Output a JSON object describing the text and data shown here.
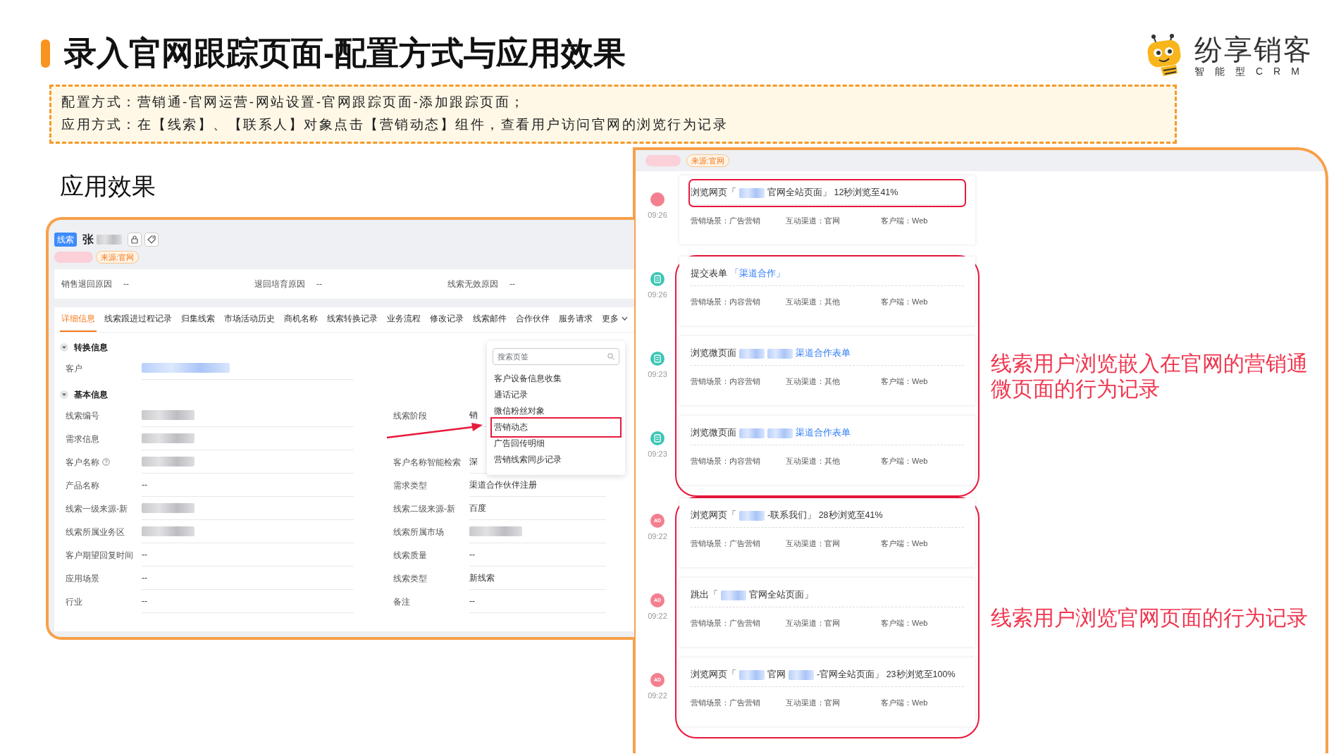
{
  "title": "录入官网跟踪页面-配置方式与应用效果",
  "logo": {
    "name": "纷享销客",
    "tagline": "智能型CRM"
  },
  "config_box": {
    "lines": [
      "配置方式：营销通-官网运营-网站设置-官网跟踪页面-添加跟踪页面；",
      "应用方式：在【线索】、【联系人】对象点击【营销动态】组件，查看用户访问官网的浏览行为记录"
    ]
  },
  "section_heading": "应用效果",
  "lead_detail": {
    "object_tag": "线索",
    "name": "张",
    "source_tag": "来源:官网",
    "summary": [
      {
        "label": "销售退回原因",
        "value": "--"
      },
      {
        "label": "退回培育原因",
        "value": "--"
      },
      {
        "label": "线索无效原因",
        "value": "--"
      }
    ],
    "tabs": [
      {
        "label": "详细信息",
        "selected": true
      },
      {
        "label": "线索跟进过程记录",
        "selected": false
      },
      {
        "label": "归集线索",
        "selected": false
      },
      {
        "label": "市场活动历史",
        "selected": false
      },
      {
        "label": "商机名称",
        "selected": false
      },
      {
        "label": "线索转换记录",
        "selected": false
      },
      {
        "label": "业务流程",
        "selected": false
      },
      {
        "label": "修改记录",
        "selected": false
      },
      {
        "label": "线索邮件",
        "selected": false
      },
      {
        "label": "合作伙伴",
        "selected": false
      },
      {
        "label": "服务请求",
        "selected": false
      },
      {
        "label": "更多",
        "selected": false,
        "kind": "more"
      }
    ],
    "sections": [
      {
        "title": "转换信息",
        "expanded": true,
        "rows": [
          [
            {
              "label": "客户",
              "kind": "redacted_link"
            }
          ]
        ]
      },
      {
        "title": "基本信息",
        "expanded": true,
        "rows": [
          [
            {
              "label": "线索编号",
              "kind": "redacted"
            },
            {
              "label": "线索阶段",
              "kind": "text",
              "value": "销"
            }
          ],
          [
            {
              "label": "需求信息",
              "kind": "redacted"
            }
          ],
          [
            {
              "label": "客户名称",
              "kind": "redacted",
              "help": true
            },
            {
              "label": "客户名称智能检索",
              "kind": "text",
              "value": "深"
            }
          ],
          [
            {
              "label": "产品名称",
              "kind": "text",
              "value": "--"
            },
            {
              "label": "需求类型",
              "kind": "text",
              "value": "渠道合作伙伴注册"
            }
          ],
          [
            {
              "label": "线索一级来源-新",
              "kind": "redacted"
            },
            {
              "label": "线索二级来源-新",
              "kind": "text",
              "value": "百度"
            }
          ],
          [
            {
              "label": "线索所属业务区",
              "kind": "redacted"
            },
            {
              "label": "线索所属市场",
              "kind": "redacted"
            }
          ],
          [
            {
              "label": "客户期望回复时间",
              "kind": "text",
              "value": "--"
            },
            {
              "label": "线索质量",
              "kind": "text",
              "value": "--"
            }
          ],
          [
            {
              "label": "应用场景",
              "kind": "text",
              "value": "--"
            },
            {
              "label": "线索类型",
              "kind": "text",
              "value": "新线索"
            }
          ],
          [
            {
              "label": "行业",
              "kind": "text",
              "value": "--"
            },
            {
              "label": "备注",
              "kind": "text",
              "value": "--"
            }
          ]
        ]
      }
    ],
    "tab_menu": {
      "placeholder": "搜索页签",
      "items": [
        {
          "label": "客户设备信息收集",
          "highlighted": false
        },
        {
          "label": "通话记录",
          "highlighted": false
        },
        {
          "label": "微信粉丝对象",
          "highlighted": false
        },
        {
          "label": "营销动态",
          "highlighted": true
        },
        {
          "label": "广告回传明细",
          "highlighted": false
        },
        {
          "label": "营销线索同步记录",
          "highlighted": false
        }
      ]
    }
  },
  "activity_panel": {
    "source_tag": "来源:官网",
    "groups": [
      {
        "kind": "single",
        "events": [
          {
            "kind": "ad",
            "time": "09:26",
            "title_highlighted": true,
            "title": [
              {
                "kind": "text",
                "text": "浏览网页「"
              },
              {
                "kind": "redacted"
              },
              {
                "kind": "text",
                "text": "官网全站页面」 12秒浏览至41%"
              }
            ],
            "meta": [
              {
                "label": "营销场景：",
                "value": "广告营销"
              },
              {
                "label": "互动渠道：",
                "value": "官网"
              },
              {
                "label": "客户端：",
                "value": "Web"
              }
            ]
          }
        ]
      },
      {
        "kind": "group",
        "annotation": "线索用户浏览嵌入在官网的营销通微页面的行为记录",
        "events": [
          {
            "kind": "form",
            "time": "09:26",
            "title_highlighted": false,
            "title": [
              {
                "kind": "text",
                "text": "提交表单"
              },
              {
                "kind": "link",
                "text": "「渠道合作」"
              }
            ],
            "meta": [
              {
                "label": "营销场景：",
                "value": "内容营销"
              },
              {
                "label": "互动渠道：",
                "value": "其他"
              },
              {
                "label": "客户端：",
                "value": "Web"
              }
            ]
          },
          {
            "kind": "form",
            "time": "09:23",
            "title_highlighted": false,
            "title": [
              {
                "kind": "text",
                "text": "浏览微页面"
              },
              {
                "kind": "redacted"
              },
              {
                "kind": "redacted"
              },
              {
                "kind": "link",
                "text": "渠道合作表单"
              }
            ],
            "meta": [
              {
                "label": "营销场景：",
                "value": "内容营销"
              },
              {
                "label": "互动渠道：",
                "value": "其他"
              },
              {
                "label": "客户端：",
                "value": "Web"
              }
            ]
          },
          {
            "kind": "form",
            "time": "09:23",
            "title_highlighted": false,
            "title": [
              {
                "kind": "text",
                "text": "浏览微页面"
              },
              {
                "kind": "redacted"
              },
              {
                "kind": "redacted"
              },
              {
                "kind": "link",
                "text": "渠道合作表单"
              }
            ],
            "meta": [
              {
                "label": "营销场景：",
                "value": "内容营销"
              },
              {
                "label": "互动渠道：",
                "value": "其他"
              },
              {
                "label": "客户端：",
                "value": "Web"
              }
            ]
          }
        ]
      },
      {
        "kind": "group",
        "annotation": "线索用户浏览官网页面的行为记录",
        "events": [
          {
            "kind": "ad",
            "badge": "AD",
            "time": "09:22",
            "title_highlighted": false,
            "title": [
              {
                "kind": "text",
                "text": "浏览网页「"
              },
              {
                "kind": "redacted"
              },
              {
                "kind": "text",
                "text": "-联系我们」 28秒浏览至41%"
              }
            ],
            "meta": [
              {
                "label": "营销场景：",
                "value": "广告营销"
              },
              {
                "label": "互动渠道：",
                "value": "官网"
              },
              {
                "label": "客户端：",
                "value": "Web"
              }
            ]
          },
          {
            "kind": "ad",
            "badge": "AD",
            "time": "09:22",
            "title_highlighted": false,
            "title": [
              {
                "kind": "text",
                "text": "跳出「"
              },
              {
                "kind": "redacted"
              },
              {
                "kind": "text",
                "text": "官网全站页面」"
              }
            ],
            "meta": [
              {
                "label": "营销场景：",
                "value": "广告营销"
              },
              {
                "label": "互动渠道：",
                "value": "官网"
              },
              {
                "label": "客户端：",
                "value": "Web"
              }
            ]
          },
          {
            "kind": "ad",
            "badge": "AD",
            "time": "09:22",
            "title_highlighted": false,
            "title": [
              {
                "kind": "text",
                "text": "浏览网页「"
              },
              {
                "kind": "redacted"
              },
              {
                "kind": "text",
                "text": "官网"
              },
              {
                "kind": "redacted"
              },
              {
                "kind": "text",
                "text": "-官网全站页面」 23秒浏览至100%"
              }
            ],
            "meta": [
              {
                "label": "营销场景：",
                "value": "广告营销"
              },
              {
                "label": "互动渠道：",
                "value": "官网"
              },
              {
                "label": "客户端：",
                "value": "Web"
              }
            ]
          }
        ]
      }
    ]
  }
}
